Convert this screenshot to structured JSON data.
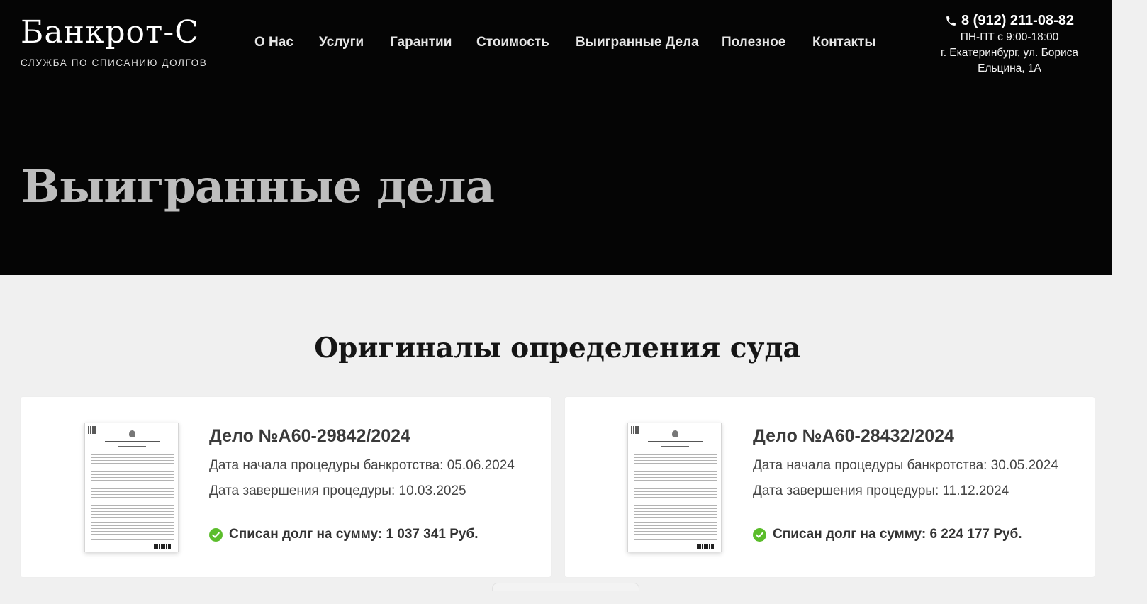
{
  "header": {
    "logo_title": "Банкрот-С",
    "logo_subtitle": "СЛУЖБА ПО СПИСАНИЮ ДОЛГОВ",
    "nav": [
      "О Нас",
      "Услуги",
      "Гарантии",
      "Стоимость",
      "Выигранные Дела",
      "Полезное",
      "Контакты"
    ],
    "phone": "8 (912) 211-08-82",
    "hours": "ПН-ПТ с 9:00-18:00",
    "address_line1": "г. Екатеринбург, ул. Бориса",
    "address_line2": "Ельцина, 1А"
  },
  "hero": {
    "title": "Выигранные дела"
  },
  "section": {
    "title": "Оригиналы определения суда"
  },
  "cases": [
    {
      "title": "Дело №А60-29842/2024",
      "start": "Дата начала процедуры банкротства: 05.06.2024",
      "end": "Дата завершения процедуры: 10.03.2025",
      "result": "Списан долг на сумму: 1 037 341 Руб."
    },
    {
      "title": "Дело №А60-28432/2024",
      "start": "Дата начала процедуры банкротства: 30.05.2024",
      "end": "Дата завершения процедуры: 11.12.2024",
      "result": "Списан долг на сумму: 6 224 177 Руб."
    }
  ],
  "icons": {
    "phone": "phone-icon",
    "check": "check-circle-icon"
  },
  "colors": {
    "hero_bg": "#050505",
    "page_bg": "#f0f0f0",
    "check_green": "#5bbd2b",
    "hero_title": "#bdbdbd"
  }
}
